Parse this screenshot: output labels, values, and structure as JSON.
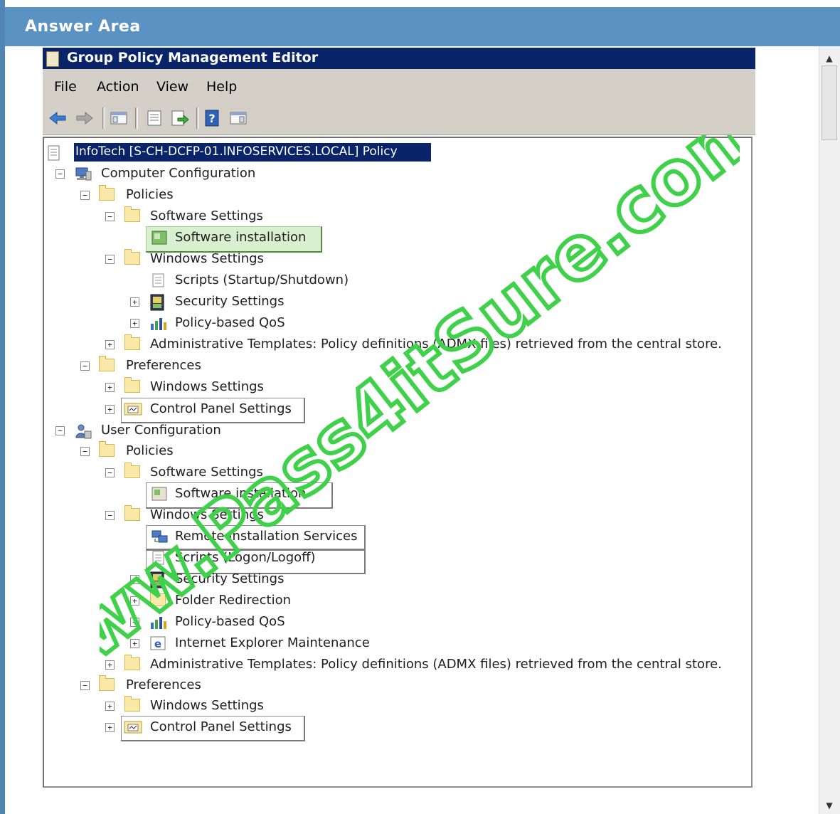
{
  "answer_area": {
    "title": "Answer Area"
  },
  "window": {
    "title": "Group Policy Management Editor",
    "menu": [
      "File",
      "Action",
      "View",
      "Help"
    ]
  },
  "tree": {
    "root": "InfoTech [S-CH-DCFP-01.INFOSERVICES.LOCAL] Policy",
    "computer": {
      "label": "Computer Configuration",
      "policies": "Policies",
      "software_settings": "Software Settings",
      "software_installation": "Software installation",
      "windows_settings": "Windows Settings",
      "scripts": "Scripts (Startup/Shutdown)",
      "security_settings": "Security Settings",
      "qos": "Policy-based QoS",
      "admin_templates": "Administrative Templates: Policy definitions (ADMX files) retrieved from the central store.",
      "preferences": "Preferences",
      "pref_windows_settings": "Windows Settings",
      "pref_control_panel": "Control Panel Settings"
    },
    "user": {
      "label": "User Configuration",
      "policies": "Policies",
      "software_settings": "Software Settings",
      "software_installation": "Software installation",
      "windows_settings": "Windows Settings",
      "remote_install": "Remote Installation Services",
      "scripts": "Scripts (Logon/Logoff)",
      "security_settings": "Security Settings",
      "folder_redirection": "Folder Redirection",
      "qos": "Policy-based QoS",
      "ie_maintenance": "Internet Explorer Maintenance",
      "admin_templates": "Administrative Templates: Policy definitions (ADMX files) retrieved from the central store.",
      "preferences": "Preferences",
      "pref_windows_settings": "Windows Settings",
      "pref_control_panel": "Control Panel Settings"
    }
  },
  "watermark": {
    "text": "www.Pass4itSure.com",
    "color": "#3fd14a"
  },
  "colors": {
    "answer_header": "#5b92c4",
    "title_bar": "#0a246a",
    "chrome": "#d4d0c8",
    "highlight_green": "#d9f0d0"
  }
}
